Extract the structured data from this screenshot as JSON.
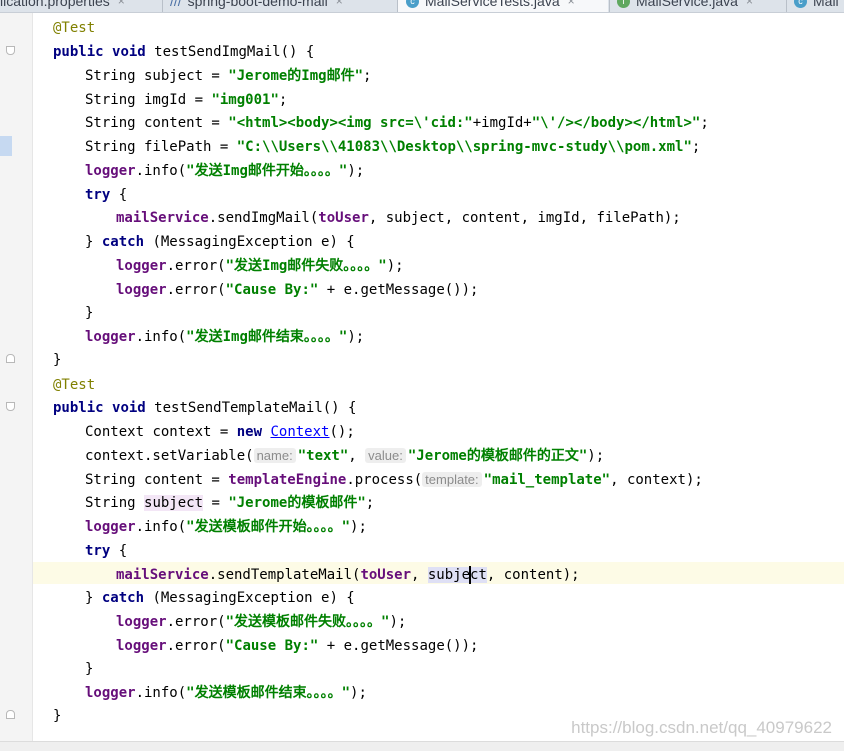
{
  "tabs": [
    {
      "label": "lication.properties",
      "icon": "properties-file-icon",
      "active": false
    },
    {
      "label": "spring-boot-demo-mail",
      "icon": "maven-module-icon",
      "active": false
    },
    {
      "label": "MailServiceTests.java",
      "icon": "class-icon",
      "active": true
    },
    {
      "label": "MailService.java",
      "icon": "interface-icon",
      "active": false
    },
    {
      "label": "Mail",
      "icon": "class-icon",
      "active": false
    }
  ],
  "tab_close_glyph": "×",
  "code": {
    "annotation": "@Test",
    "public": "public",
    "void": "void",
    "try": "try",
    "catch": "catch",
    "new": "new",
    "String": "String",
    "method1": "testSendImgMail() {",
    "method2": "testSendTemplateMail() {",
    "subject_decl": " subject = ",
    "subject_var": "subject",
    "subject_str1": "\"Jerome的Img邮件\"",
    "imgId_decl": " imgId = ",
    "imgId_str": "\"img001\"",
    "content_decl": " content = ",
    "content_str1": "\"<html><body><img src=\\'cid:\"",
    "content_concat": "+imgId+",
    "content_str2": "\"\\'/></body></html>\"",
    "filePath_decl": " filePath = ",
    "filePath_str": "\"C:\\\\Users\\\\41083\\\\Desktop\\\\spring-mvc-study\\\\pom.xml\"",
    "logger": "logger",
    "info": ".info(",
    "error": ".error(",
    "log_img_start": "\"发送Img邮件开始。。。。\"",
    "log_img_fail": "\"发送Img邮件失败。。。。\"",
    "log_img_end": "\"发送Img邮件结束。。。。\"",
    "log_cause": "\"Cause By:\"",
    "cause_rest": " + e.getMessage());",
    "mailService": "mailService",
    "sendImg": ".sendImgMail(",
    "toUser": "toUser",
    "sendImg_args": ", subject, content, imgId, filePath);",
    "catch_open": "} ",
    "catch_args": " (MessagingException e) {",
    "close_brace": "}",
    "close_paren": ");",
    "semi": ";",
    "try_open": " {",
    "Context": "Context",
    "context_decl": " context = ",
    "context_new_end": "();",
    "setVariable": "context.setVariable(",
    "hint_name": "name:",
    "var_text": "\"text\"",
    "comma": ", ",
    "hint_value": "value:",
    "var_value": "\"Jerome的模板邮件的正文\"",
    "templateEngine": "templateEngine",
    "process": ".process(",
    "hint_template": "template:",
    "template_name": "\"mail_template\"",
    "process_end": ", context);",
    "subject_str2": "\"Jerome的模板邮件\"",
    "log_tpl_start": "\"发送模板邮件开始。。。。\"",
    "log_tpl_fail": "\"发送模板邮件失败。。。。\"",
    "log_tpl_end": "\"发送模板邮件结束。。。。\"",
    "sendTpl": ".sendTemplateMail(",
    "subj_a": "subje",
    "subj_b": "ct",
    "sendTpl_end": ", content);"
  },
  "watermark": "https://blog.csdn.net/qq_40979622"
}
